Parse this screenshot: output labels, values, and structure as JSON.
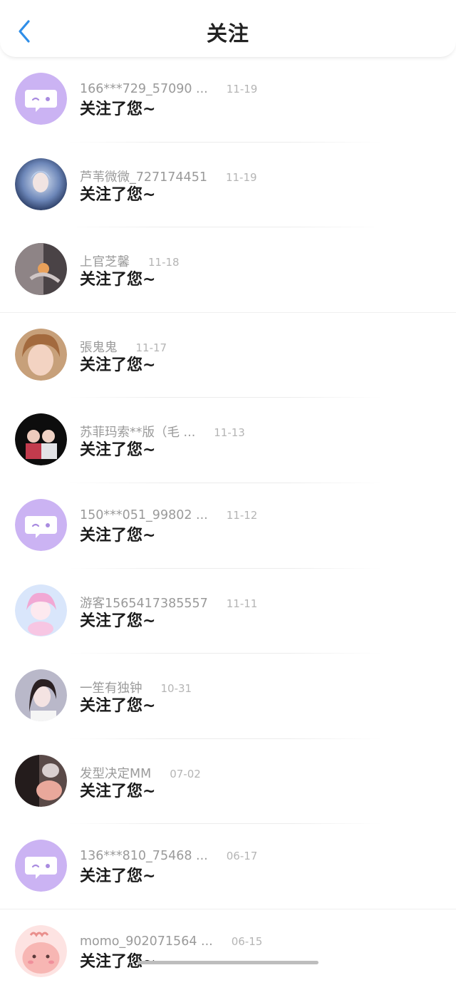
{
  "header": {
    "title": "关注",
    "back_icon": "chevron-left-icon"
  },
  "colors": {
    "accent": "#2f8ee8",
    "default_avatar": "#cbb3f3"
  },
  "items": [
    {
      "name": "166***729_57090 ...",
      "time": "11-19",
      "message": "关注了您~",
      "avatar": "default-chat-bubble"
    },
    {
      "name": "芦苇微微_727174451",
      "time": "11-19",
      "message": "关注了您~",
      "avatar": "photo"
    },
    {
      "name": "上官芝馨",
      "time": "11-18",
      "message": "关注了您~",
      "avatar": "photo"
    },
    {
      "name": "張鬼鬼",
      "time": "11-17",
      "message": "关注了您~",
      "avatar": "photo"
    },
    {
      "name": "苏菲玛索**版（毛 ...",
      "time": "11-13",
      "message": "关注了您~",
      "avatar": "photo"
    },
    {
      "name": "150***051_99802 ...",
      "time": "11-12",
      "message": "关注了您~",
      "avatar": "default-chat-bubble"
    },
    {
      "name": "游客1565417385557",
      "time": "11-11",
      "message": "关注了您~",
      "avatar": "photo"
    },
    {
      "name": "一笙有独钟",
      "time": "10-31",
      "message": "关注了您~",
      "avatar": "photo"
    },
    {
      "name": "发型决定MM",
      "time": "07-02",
      "message": "关注了您~",
      "avatar": "photo"
    },
    {
      "name": "136***810_75468 ...",
      "time": "06-17",
      "message": "关注了您~",
      "avatar": "default-chat-bubble"
    },
    {
      "name": "momo_902071564 ...",
      "time": "06-15",
      "message": "关注了您~",
      "avatar": "photo"
    }
  ]
}
